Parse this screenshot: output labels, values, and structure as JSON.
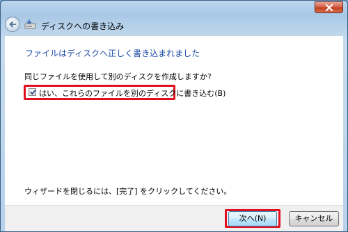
{
  "window": {
    "close_icon": "close-x-icon"
  },
  "nav": {
    "back_icon": "back-arrow-icon",
    "wizard_icon": "disc-burn-icon",
    "title": "ディスクへの書き込み"
  },
  "main": {
    "heading": "ファイルはディスクへ正しく書き込まれました",
    "question": "同じファイルを使用して別のディスクを作成しますか?",
    "checkbox": {
      "label": "はい、これらのファイルを別のディスクに書き込む(B)",
      "checked": true
    },
    "hint": "ウィザードを閉じるには、[完了] をクリックしてください。"
  },
  "footer": {
    "next_label": "次へ(N)",
    "cancel_label": "キャンセル"
  },
  "colors": {
    "heading": "#1e4aa8",
    "highlight": "#e01020"
  }
}
